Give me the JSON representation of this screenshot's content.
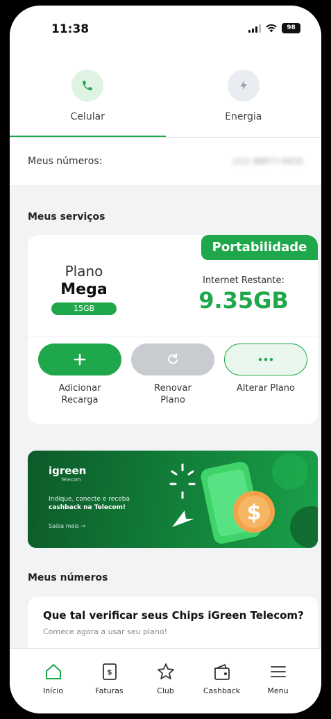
{
  "status": {
    "time": "11:38",
    "battery": "98"
  },
  "tabs": [
    {
      "label": "Celular",
      "active": true,
      "icon": "phone-icon"
    },
    {
      "label": "Energia",
      "active": false,
      "icon": "bolt-icon"
    }
  ],
  "numbers": {
    "label": "Meus números:",
    "value": "(11) 98877-6655"
  },
  "services": {
    "title": "Meus serviços",
    "badge": "Portabilidade",
    "plan_word": "Plano",
    "plan_name": "Mega",
    "plan_gb": "15GB",
    "internet_label": "Internet Restante:",
    "internet_value": "9.35GB",
    "actions": [
      {
        "label_line1": "Adicionar",
        "label_line2": "Recarga",
        "icon": "plus-icon"
      },
      {
        "label_line1": "Renovar",
        "label_line2": "Plano",
        "icon": "refresh-icon"
      },
      {
        "label_line1": "Alterar Plano",
        "label_line2": "",
        "icon": "more-icon"
      }
    ]
  },
  "banner": {
    "logo": "igreen",
    "logo_sub": "Telecom",
    "text_line1": "Indique, conecte e receba",
    "text_line2": "cashback na Telecom!",
    "link": "Saiba mais →"
  },
  "my_numbers": {
    "title": "Meus números",
    "card_title": "Que tal verificar seus Chips iGreen Telecom?",
    "card_sub": "Comece agora a usar seu plano!"
  },
  "nav": [
    {
      "label": "Início",
      "icon": "home-icon"
    },
    {
      "label": "Faturas",
      "icon": "invoice-icon"
    },
    {
      "label": "Club",
      "icon": "star-icon"
    },
    {
      "label": "Cashback",
      "icon": "wallet-icon"
    },
    {
      "label": "Menu",
      "icon": "menu-icon"
    }
  ],
  "colors": {
    "brand_green": "#1fa84b",
    "banner_dark": "#0d5a2a"
  }
}
